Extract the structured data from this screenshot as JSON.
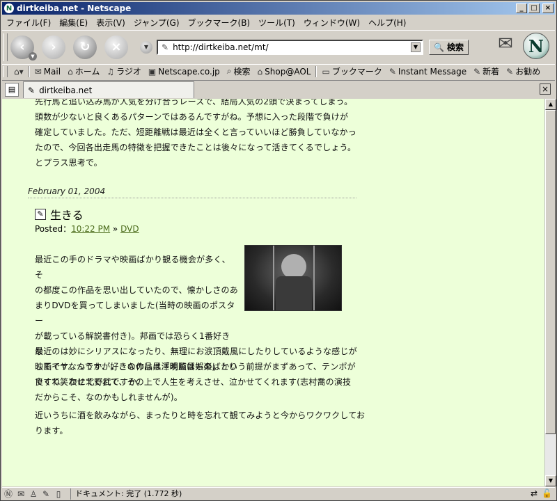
{
  "window": {
    "title": "dirtkeiba.net - Netscape"
  },
  "menu": [
    "ファイル(F)",
    "編集(E)",
    "表示(V)",
    "ジャンプ(G)",
    "ブックマーク(B)",
    "ツール(T)",
    "ウィンドウ(W)",
    "ヘルプ(H)"
  ],
  "nav": {
    "url": "http://dirtkeiba.net/mt/",
    "search_label": "検索"
  },
  "bookmarks": [
    {
      "label": "Mail",
      "icon": "mail-icon"
    },
    {
      "label": "ホーム",
      "icon": "home-icon"
    },
    {
      "label": "ラジオ",
      "icon": "radio-icon"
    },
    {
      "label": "Netscape.co.jp",
      "icon": "my-netscape-icon"
    },
    {
      "label": "検索",
      "icon": "search-icon"
    },
    {
      "label": "Shop@AOL",
      "icon": "shop-icon"
    },
    {
      "label": "ブックマーク",
      "icon": "folder-icon"
    },
    {
      "label": "Instant Message",
      "icon": "link-icon"
    },
    {
      "label": "新着",
      "icon": "link-icon"
    },
    {
      "label": "お勧め",
      "icon": "link-icon"
    }
  ],
  "tab": {
    "label": "dirtkeiba.net"
  },
  "post_prev": {
    "lines": [
      "先行馬と追い込み馬が人気を分け合うレースで、結局人気の2頭で決まってしまう。",
      "頭数が少ないと良くあるパターンではあるんですがね。予想に入った段階で負けが",
      "確定していました。ただ、短距離戦は最近は全くと言っていいほど勝負していなかっ",
      "たので、今回各出走馬の特徴を把握できたことは後々になって活きてくるでしょう。",
      "とプラス思考で。"
    ]
  },
  "post": {
    "date": "February 01, 2004",
    "title": "生きる",
    "posted_prefix": "Posted：",
    "time": "10:22 PM",
    "sep": " » ",
    "category": "DVD",
    "para1": [
      "最近この手のドラマや映画ばかり観る機会が多く、そ",
      "の都度この作品を思い出していたので、懐かしさのあ",
      "まりDVDを買ってしまいました(当時の映画のポスター",
      "が載っている解説書付き)。邦画では恐らく1番好きな",
      "映画です。つうか、好きなのは黒澤明監督ものばかり",
      "ですね。次に北野武ですか。"
    ],
    "para2": [
      "最近のは妙にシリアスになったり、無理にお涙頂戴風にしたりしているような感じが",
      "してイヤなんですが、この作品は「映画は娯楽」という前提がまずあって、テンポが",
      "良くて笑わせてくれて、その上で人生を考えさせ、泣かせてくれます(志村喬の演技",
      "だからこそ、なのかもしれませんが)。"
    ],
    "para3": [
      "近いうちに酒を飲みながら、まったりと時を忘れて観てみようと今からワクワクしてお",
      "ります。"
    ]
  },
  "status": {
    "text": "ドキュメント: 完了 (1.772 秒)"
  }
}
